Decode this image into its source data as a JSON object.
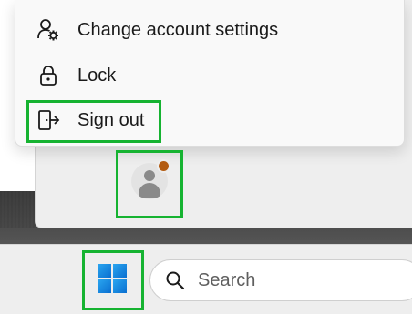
{
  "account_menu": {
    "items": [
      {
        "label": "Change account settings",
        "icon": "account-settings-icon"
      },
      {
        "label": "Lock",
        "icon": "lock-icon"
      },
      {
        "label": "Sign out",
        "icon": "sign-out-icon"
      }
    ]
  },
  "user": {
    "avatar_icon": "person-icon",
    "status_color": "#b35c12"
  },
  "taskbar": {
    "start_icon": "windows-logo-icon",
    "search_placeholder": "Search",
    "search_icon": "search-icon"
  },
  "colors": {
    "highlight": "#16b331",
    "windows_blue": "#1f8ee0"
  }
}
